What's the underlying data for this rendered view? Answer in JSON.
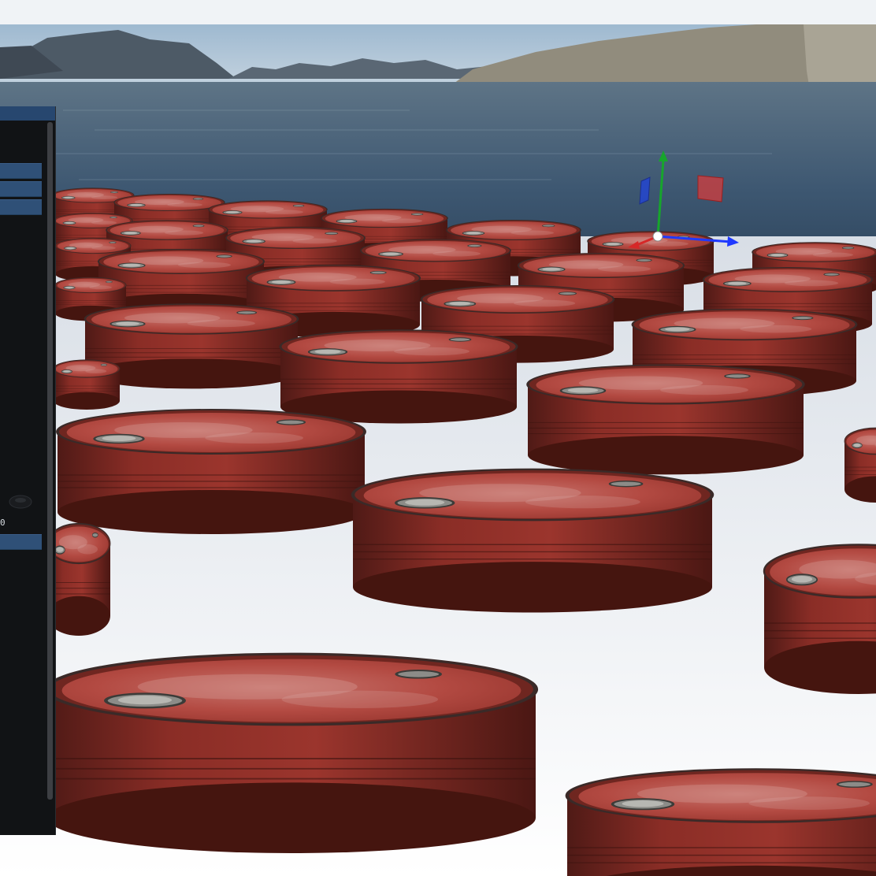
{
  "window": {
    "title": ""
  },
  "inspector": {
    "rows": [
      "",
      "",
      "",
      ""
    ],
    "value_text": "0"
  },
  "scene": {
    "object": "red-oil-drums",
    "gizmo": {
      "type": "translate",
      "axes": [
        "x-axis",
        "y-axis",
        "z-axis"
      ],
      "axis_colors": {
        "x": "#1f39ff",
        "y": "#17a52c",
        "z": "#d62828"
      },
      "plane_handles": [
        "xy-plane",
        "yz-plane"
      ]
    },
    "environment": [
      "sky",
      "mountains",
      "sea"
    ]
  },
  "colors": {
    "panel_header": "#27476f",
    "panel_row": "#2f5077",
    "panel_bg": "#111315",
    "drum_red": "#a53a32"
  }
}
